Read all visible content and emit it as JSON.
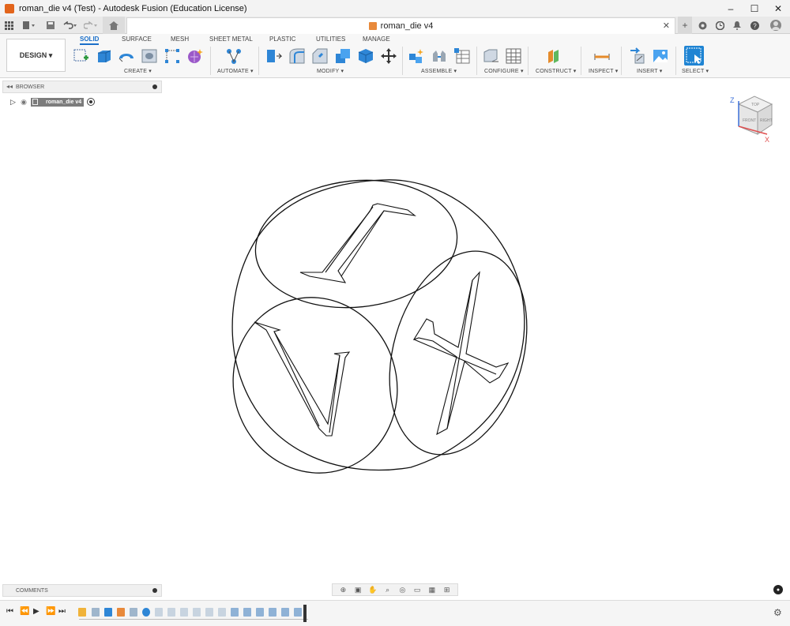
{
  "window": {
    "title": "roman_die v4 (Test) - Autodesk Fusion (Education License)",
    "controls": [
      "–",
      "☐",
      "✕"
    ]
  },
  "document_tab": {
    "name": "roman_die v4",
    "close": "✕"
  },
  "ribbon": {
    "workspace": "DESIGN ▾",
    "tabs": [
      "SOLID",
      "SURFACE",
      "MESH",
      "SHEET METAL",
      "PLASTIC",
      "UTILITIES",
      "MANAGE"
    ],
    "active_tab": "SOLID",
    "groups": [
      "CREATE ▾",
      "AUTOMATE ▾",
      "MODIFY ▾",
      "ASSEMBLE ▾",
      "CONFIGURE ▾",
      "CONSTRUCT ▾",
      "INSPECT ▾",
      "INSERT ▾",
      "SELECT ▾"
    ]
  },
  "browser": {
    "label": "BROWSER",
    "root_component": "roman_die v4"
  },
  "comments": {
    "label": "COMMENTS"
  },
  "model": {
    "face_letters": [
      "I",
      "V",
      "X"
    ]
  },
  "viewcube": {
    "axis_z": "Z",
    "axis_x": "X",
    "face_top": "TOP",
    "face_front": "FRONT",
    "face_right": "RIGHT",
    "axis_colors": {
      "x": "#e05050",
      "z": "#3b6fd8"
    }
  },
  "colors": {
    "accent": "#1a6fc9",
    "select_blue": "#1f84d3",
    "design_orange": "#e2641b"
  }
}
